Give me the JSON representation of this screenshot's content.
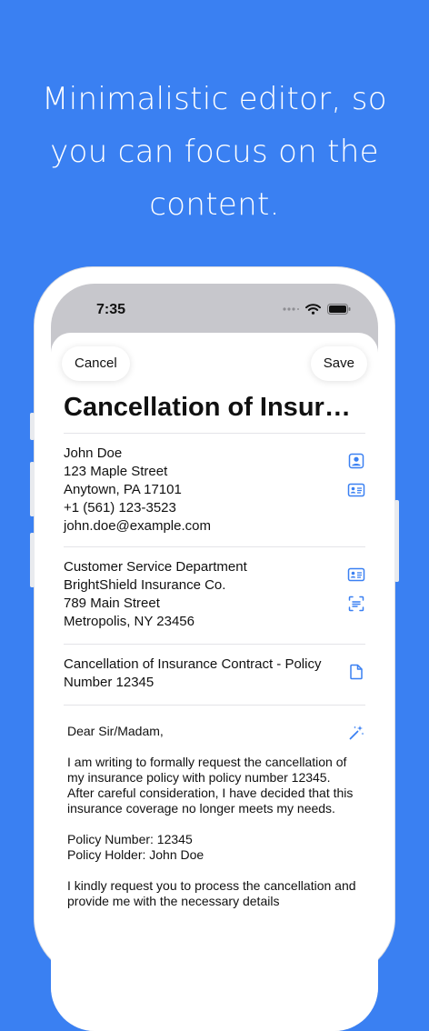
{
  "headline": [
    "Minimalistic editor, so",
    "you can focus on the",
    "content."
  ],
  "status_bar": {
    "time": "7:35"
  },
  "toolbar": {
    "cancel_label": "Cancel",
    "save_label": "Save"
  },
  "document": {
    "title": "Cancellation of Insura…",
    "sender": [
      "John Doe",
      "123 Maple Street",
      "Anytown, PA 17101",
      "+1 (561) 123-3523",
      "john.doe@example.com"
    ],
    "recipient": [
      "Customer Service Department",
      "BrightShield Insurance Co.",
      "789 Main Street",
      "Metropolis, NY 23456"
    ],
    "subject": [
      "Cancellation of Insurance Contract - Policy",
      "Number 12345"
    ],
    "body": {
      "greeting": "Dear Sir/Madam,",
      "paragraph1": "I am writing to formally request the cancellation of my insurance policy with policy number 12345. After careful consideration, I have decided that this insurance coverage no longer meets my needs.",
      "policy_number": "Policy Number: 12345",
      "policy_holder": "Policy Holder: John Doe",
      "paragraph2": "I kindly request you to process the cancellation and provide me with the necessary details"
    }
  },
  "colors": {
    "background": "#3a80f2",
    "accent": "#3a80f2"
  },
  "icons": [
    "person-crop-square-icon",
    "contact-card-icon",
    "contact-card-icon",
    "text-scan-icon",
    "document-icon",
    "magic-wand-icon"
  ]
}
